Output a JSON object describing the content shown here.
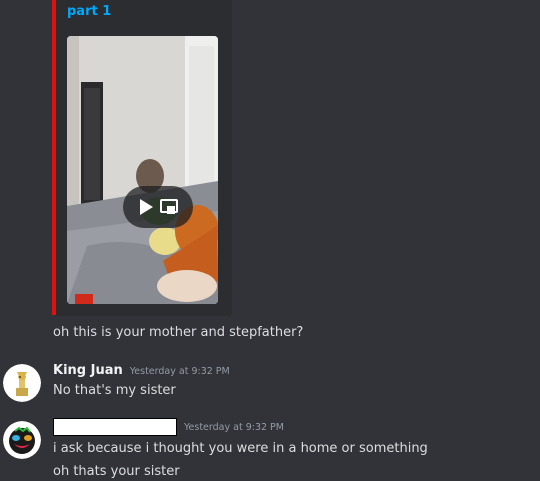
{
  "embed": {
    "title": "part 1",
    "accent_color": "#e01010",
    "title_color": "#00a8fc",
    "media_type": "video",
    "play_icon": "play-icon",
    "popout_icon": "popout-icon"
  },
  "messages": [
    {
      "continuation": true,
      "text": "oh this is your mother and stepfather?"
    },
    {
      "author": "King Juan",
      "timestamp": "Yesterday at 9:32 PM",
      "avatar_icon": "giraffe-avatar",
      "lines": [
        "No that's my sister"
      ]
    },
    {
      "author": "",
      "author_redacted": true,
      "timestamp": "Yesterday at 9:32 PM",
      "avatar_icon": "face-avatar",
      "lines": [
        "i ask because i thought you were in a home or something",
        "oh thats your sister"
      ]
    }
  ],
  "colors": {
    "background": "#313338",
    "embed_background": "#2b2d31",
    "text": "#dbdee1",
    "username": "#f2f3f5",
    "timestamp": "#949ba4"
  }
}
